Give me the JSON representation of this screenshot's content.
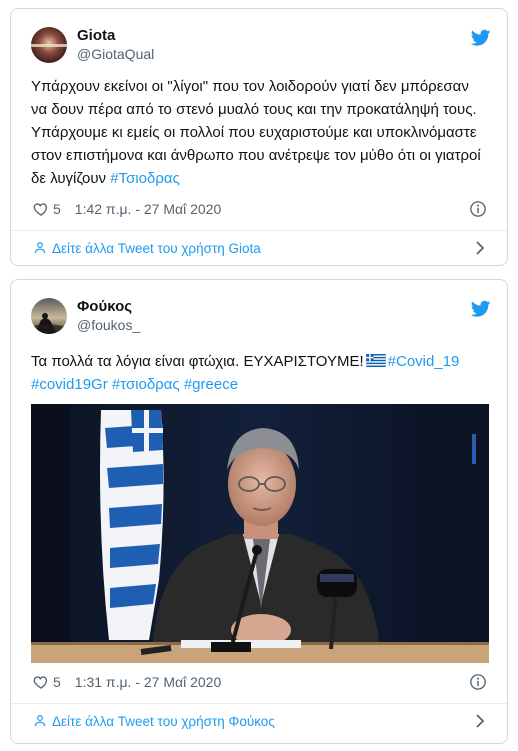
{
  "tweets": [
    {
      "display_name": "Giota",
      "handle": "@GiotaQual",
      "text": "Υπάρχουν εκείνοι οι \"λίγοι\" που τον λοιδορούν γιατί δεν μπόρεσαν να δουν πέρα από το στενό μυαλό τους και την προκατάληψή τους. Υπάρχουμε κι εμείς οι πολλοί που  ευχαριστούμε και υποκλινόμαστε στον επιστήμονα και άνθρωπο που ανέτρεψε τον μύθο ότι οι γιατροί δε λυγίζουν",
      "hashtag": "#Τσιοδρας",
      "likes": "5",
      "timestamp": "1:42 π.μ. - 27 Μαΐ 2020",
      "more_link": "Δείτε άλλα Tweet του χρήστη Giota"
    },
    {
      "display_name": "Φούκος",
      "handle": "@foukos_",
      "text": "Τα πολλά τα λόγια είναι φτώχια.  ΕΥΧΑΡΙΣΤΟΥΜΕ!",
      "hashtags_line1": "#Covid_19",
      "hashtags_line2": [
        "#covid19Gr",
        "#τσιοδρας",
        "#greece"
      ],
      "likes": "5",
      "timestamp": "1:31 π.μ. - 27 Μαΐ 2020",
      "more_link": "Δείτε άλλα Tweet του χρήστη Φούκος"
    }
  ],
  "icons": {
    "brand": "twitter-bird-icon",
    "like": "heart-icon",
    "info": "info-icon",
    "profile": "person-icon",
    "chevron": "chevron-right-icon"
  },
  "colors": {
    "accent": "#1d9bf0",
    "text": "#0f1419",
    "muted": "#536471",
    "border": "#cfd9de"
  }
}
